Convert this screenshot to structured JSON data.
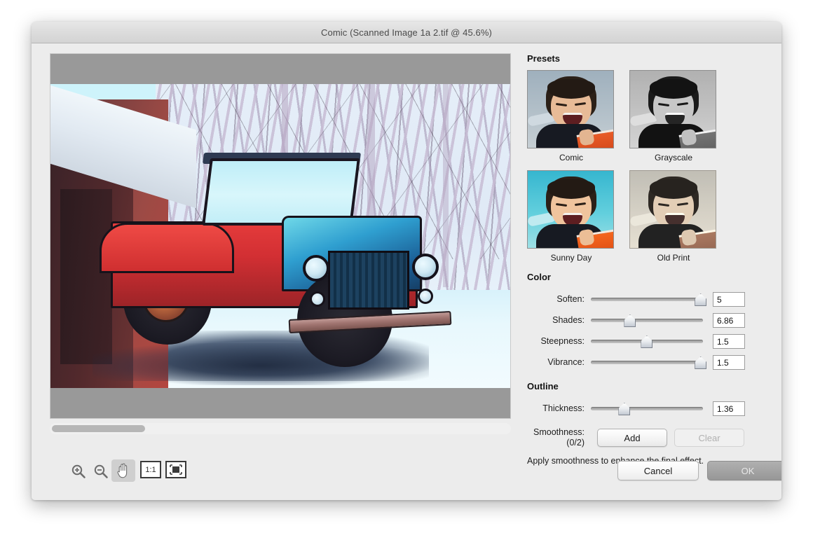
{
  "window": {
    "title": "Comic (Scanned Image 1a 2.tif @ 45.6%)"
  },
  "presets": {
    "heading": "Presets",
    "items": [
      {
        "label": "Comic"
      },
      {
        "label": "Grayscale"
      },
      {
        "label": "Sunny Day"
      },
      {
        "label": "Old Print"
      }
    ]
  },
  "color": {
    "heading": "Color",
    "sliders": [
      {
        "label": "Soften:",
        "value": "5",
        "percent": 97
      },
      {
        "label": "Shades:",
        "value": "6.86",
        "percent": 34
      },
      {
        "label": "Steepness:",
        "value": "1.5",
        "percent": 49
      },
      {
        "label": "Vibrance:",
        "value": "1.5",
        "percent": 97
      }
    ]
  },
  "outline": {
    "heading": "Outline",
    "thickness": {
      "label": "Thickness:",
      "value": "1.36",
      "percent": 29
    },
    "smoothness_label": "Smoothness:",
    "smoothness_count": "(0/2)",
    "add_label": "Add",
    "clear_label": "Clear",
    "hint": "Apply smoothness to enhance the final effect."
  },
  "toolbar": {
    "zoom_in": "zoom-in",
    "zoom_out": "zoom-out",
    "hand": "hand",
    "actual_size_label": "1:1",
    "fit_label": "fit-to-window"
  },
  "footer": {
    "cancel_label": "Cancel",
    "ok_label": "OK"
  },
  "colors": {
    "window_bg": "#ececec",
    "canvas_letterbox": "#999999",
    "ok_button": "#a2a2a2"
  }
}
